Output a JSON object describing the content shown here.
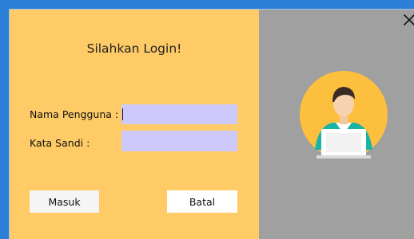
{
  "window": {
    "close_icon": "close-icon",
    "title": "Silahkan Login!"
  },
  "form": {
    "username_label": "Nama Pengguna :",
    "username_value": "",
    "password_label": "Kata Sandi :",
    "password_value": ""
  },
  "buttons": {
    "login_label": "Masuk",
    "cancel_label": "Batal"
  },
  "illustration": {
    "icon": "user-laptop-avatar-icon"
  },
  "colors": {
    "left_panel": "#fecb66",
    "right_panel": "#a0a0a0",
    "input_bg": "#cdc9fb",
    "window_border": "#2b7fd6"
  }
}
